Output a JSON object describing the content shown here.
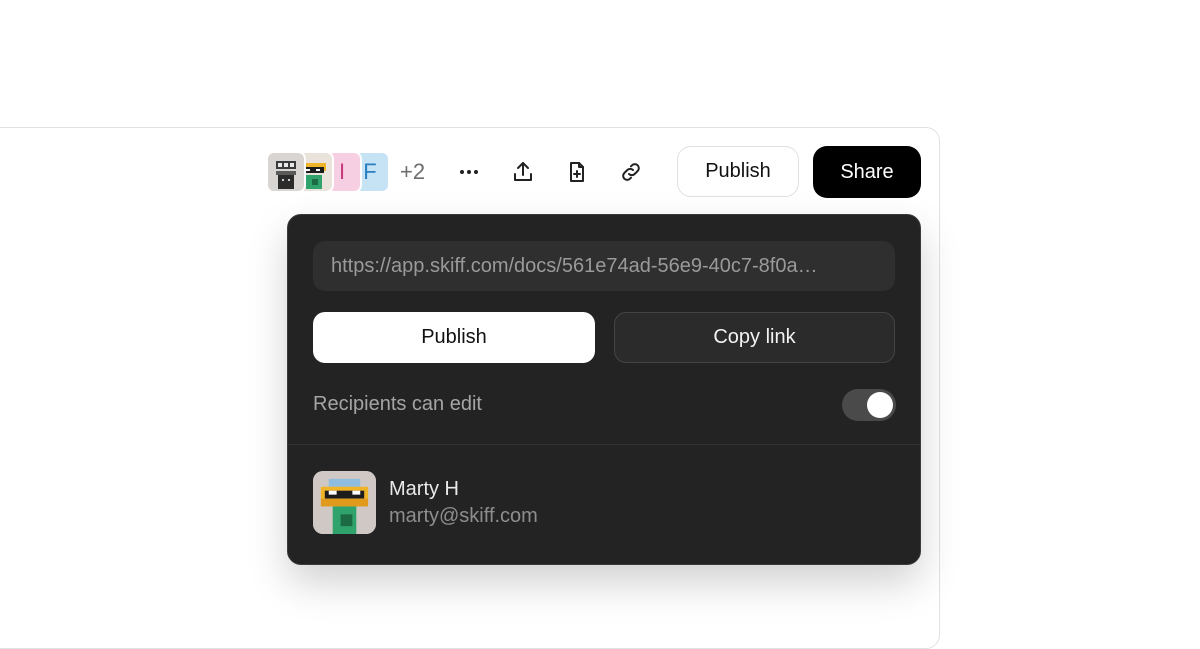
{
  "header": {
    "collaborators": {
      "initials": [
        "I",
        "F"
      ],
      "extra_count": "+2"
    },
    "actions": {
      "more_icon": "more-horizontal-icon",
      "export_icon": "upload-icon",
      "new_doc_icon": "file-plus-icon",
      "link_icon": "link-icon"
    },
    "publish_label": "Publish",
    "share_label": "Share"
  },
  "share_panel": {
    "url": "https://app.skiff.com/docs/561e74ad-56e9-40c7-8f0a…",
    "publish_label": "Publish",
    "copy_link_label": "Copy link",
    "recipients_can_edit_label": "Recipients can edit",
    "recipients_can_edit": true,
    "user": {
      "name": "Marty H",
      "email": "marty@skiff.com"
    }
  },
  "colors": {
    "panel_bg": "#232323",
    "share_button_bg": "#000000"
  }
}
